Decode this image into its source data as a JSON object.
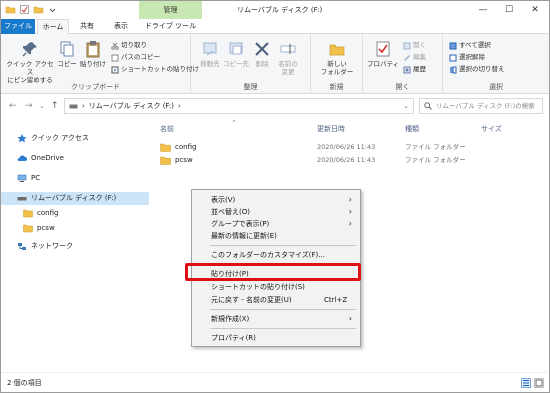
{
  "title_bar": {
    "manage_tab": "管理",
    "window_title": "リムーバブル ディスク (F:)",
    "minimize": "—",
    "maximize": "☐",
    "close": "✕"
  },
  "tabs": {
    "file": "ファイル",
    "home": "ホーム",
    "share": "共有",
    "view": "表示",
    "drive_tools": "ドライブ ツール"
  },
  "ribbon": {
    "clipboard": {
      "label": "クリップボード",
      "pin_line1": "クイック アクセス",
      "pin_line2": "にピン留めする",
      "copy": "コピー",
      "paste": "貼り付け",
      "cut": "切り取り",
      "copy_path": "パスのコピー",
      "paste_shortcut": "ショートカットの貼り付け"
    },
    "organize": {
      "label": "整理",
      "move_to": "移動先",
      "copy_to": "コピー先",
      "delete": "削除",
      "rename_line1": "名前の",
      "rename_line2": "変更"
    },
    "new": {
      "label": "新規",
      "new_folder_line1": "新しい",
      "new_folder_line2": "フォルダー"
    },
    "open": {
      "label": "開く",
      "properties": "プロパティ",
      "open": "開く",
      "edit": "編集",
      "history": "履歴"
    },
    "select": {
      "label": "選択",
      "select_all": "すべて選択",
      "select_none": "選択解除",
      "invert": "選択の切り替え"
    }
  },
  "address": {
    "back": "←",
    "forward": "→",
    "recent": "⌄",
    "up": "↑",
    "path": "リムーバブル ディスク (F:)",
    "sep": "›",
    "search_placeholder": "リムーバブル ディスク (F:)の検索"
  },
  "nav_pane": {
    "quick_access": "クイック アクセス",
    "onedrive": "OneDrive",
    "pc": "PC",
    "removable": "リムーバブル ディスク (F:)",
    "config": "config",
    "pcsw": "pcsw",
    "network": "ネットワーク"
  },
  "file_list": {
    "columns": {
      "name": "名前",
      "date": "更新日時",
      "type": "種類",
      "size": "サイズ"
    },
    "rows": [
      {
        "name": "config",
        "date": "2020/06/26 11:43",
        "type": "ファイル フォルダー"
      },
      {
        "name": "pcsw",
        "date": "2020/06/26 11:43",
        "type": "ファイル フォルダー"
      }
    ]
  },
  "context_menu": {
    "items": [
      {
        "label": "表示(V)",
        "arrow": "›"
      },
      {
        "label": "並べ替え(O)",
        "arrow": "›"
      },
      {
        "label": "グループで表示(P)",
        "arrow": "›"
      },
      {
        "label": "最新の情報に更新(E)"
      },
      {
        "label": "このフォルダーのカスタマイズ(F)..."
      },
      {
        "label": "貼り付け(P)"
      },
      {
        "label": "ショートカットの貼り付け(S)"
      },
      {
        "label": "元に戻す - 名前の変更(U)",
        "shortcut": "Ctrl+Z"
      },
      {
        "label": "新規作成(X)",
        "arrow": "›"
      },
      {
        "label": "プロパティ(R)"
      }
    ]
  },
  "status_bar": {
    "count": "2 個の項目"
  },
  "colors": {
    "file_tab": "#1979ca",
    "manage_tab": "#c9e7b3",
    "selection": "#cce4f7",
    "highlight": "#e01010",
    "folder": "#f3c14b"
  }
}
